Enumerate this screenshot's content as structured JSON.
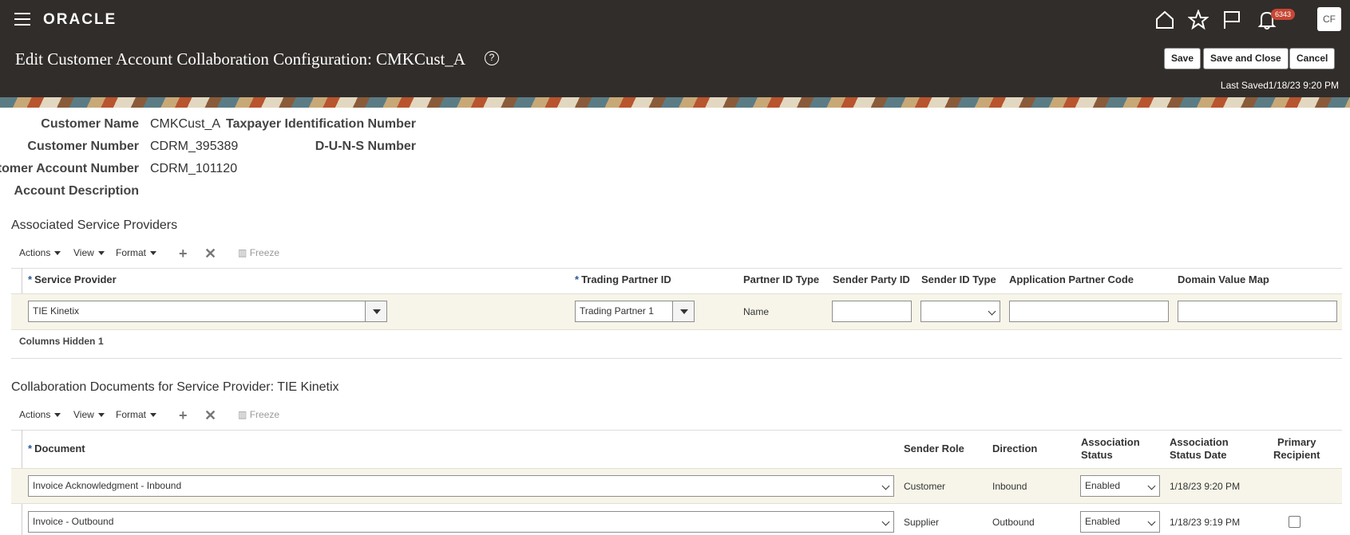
{
  "brand": {
    "logo": "ORACLE"
  },
  "topbar": {
    "icons": [
      "menu-icon",
      "home-icon",
      "star-icon",
      "flag-icon",
      "bell-icon"
    ],
    "notification_count": "6343",
    "avatar_initials": "CF"
  },
  "header": {
    "title": "Edit Customer Account Collaboration Configuration: CMKCust_A",
    "save_label": "Save",
    "save_close_label": "Save and Close",
    "cancel_label": "Cancel",
    "last_saved": "Last Saved1/18/23 9:20 PM"
  },
  "form": {
    "customer_name_label": "Customer Name",
    "customer_name": "CMKCust_A",
    "customer_number_label": "Customer Number",
    "customer_number": "CDRM_395389",
    "account_number_label": "Customer Account Number",
    "account_number": "CDRM_101120",
    "account_description_label": "Account Description",
    "taxpayer_label": "Taxpayer Identification Number",
    "duns_label": "D-U-N-S Number"
  },
  "providers": {
    "title": "Associated Service Providers",
    "toolbar": {
      "actions": "Actions",
      "view": "View",
      "format": "Format",
      "freeze": "Freeze"
    },
    "columns": {
      "service_provider": "Service Provider",
      "trading_partner_id": "Trading Partner ID",
      "partner_id_type": "Partner ID Type",
      "sender_party_id": "Sender Party ID",
      "sender_id_type": "Sender ID Type",
      "application_partner_code": "Application Partner Code",
      "domain_value_map": "Domain Value Map"
    },
    "row": {
      "service_provider": "TIE Kinetix",
      "trading_partner_id": "Trading Partner 1",
      "partner_id_type": "Name"
    },
    "columns_hidden_label": "Columns Hidden",
    "columns_hidden_count": "1"
  },
  "documents": {
    "title": "Collaboration Documents for Service Provider: TIE Kinetix",
    "toolbar": {
      "actions": "Actions",
      "view": "View",
      "format": "Format",
      "freeze": "Freeze"
    },
    "columns": {
      "document": "Document",
      "sender_role": "Sender Role",
      "direction": "Direction",
      "association_status_1": "Association",
      "association_status_2": "Status",
      "association_status_date_1": "Association",
      "association_status_date_2": "Status Date",
      "primary_recipient_1": "Primary",
      "primary_recipient_2": "Recipient"
    },
    "rows": [
      {
        "document": "Invoice Acknowledgment - Inbound",
        "sender_role": "Customer",
        "direction": "Inbound",
        "status": "Enabled",
        "status_date": "1/18/23 9:20 PM",
        "primary": false
      },
      {
        "document": "Invoice - Outbound",
        "sender_role": "Supplier",
        "direction": "Outbound",
        "status": "Enabled",
        "status_date": "1/18/23 9:19 PM",
        "primary": false
      }
    ]
  }
}
